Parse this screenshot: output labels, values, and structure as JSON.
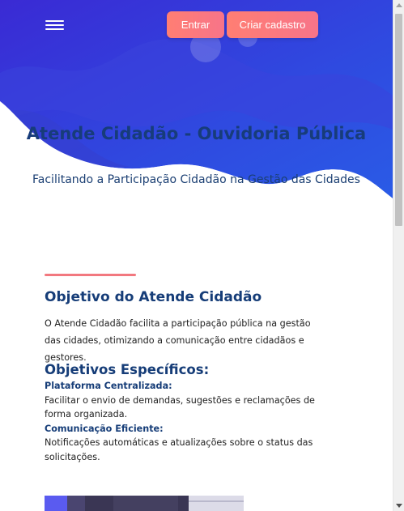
{
  "header": {
    "menu_icon": "hamburger-menu-icon",
    "login_label": "Entrar",
    "signup_label": "Criar cadastro"
  },
  "hero": {
    "title": "Atende Cidadão - Ouvidoria Pública",
    "subtitle": "Facilitando a Participação Cidadão na Gestão das Cidades"
  },
  "about": {
    "title": "Objetivo do Atende Cidadão",
    "text": "O Atende Cidadão facilita a participação pública na gestão das cidades, otimizando a comunicação entre cidadãos e gestores."
  },
  "objectives": {
    "title": "Objetivos Específicos:",
    "items": [
      {
        "label": "Plataforma Centralizada:",
        "desc": "Facilitar o envio de demandas, sugestões e reclamações de forma organizada."
      },
      {
        "label": "Comunicação Eficiente:",
        "desc": "Notificações automáticas e atualizações sobre o status das solicitações."
      }
    ]
  },
  "colors": {
    "hero_gradient_start": "#3a2fd6",
    "hero_gradient_end": "#2a5be6",
    "button_gradient_start": "#ff7e73",
    "button_gradient_end": "#f77489",
    "heading": "#163d78",
    "accent": "#f2787f"
  }
}
